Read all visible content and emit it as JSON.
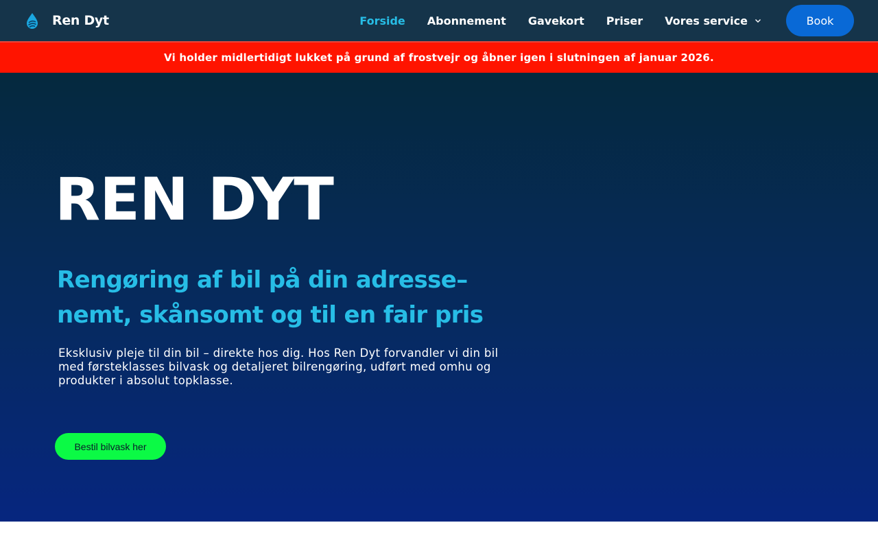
{
  "header": {
    "brand_name": "Ren Dyt",
    "logo_icon": "water-drop-icon",
    "nav": [
      {
        "label": "Forside",
        "active": true
      },
      {
        "label": "Abonnement"
      },
      {
        "label": "Gavekort"
      },
      {
        "label": "Priser"
      },
      {
        "label": "Vores service",
        "has_dropdown": true
      }
    ],
    "book_label": "Book"
  },
  "notice": {
    "text": "Vi holder midlertidigt lukket på grund af frostvejr og åbner igen i slutningen af januar 2026."
  },
  "hero": {
    "title": "REN DYT",
    "subtitle": "Rengøring af bil på din adresse– nemt, skånsomt og til en fair pris",
    "description": "Eksklusiv pleje til din bil – direkte hos dig. Hos Ren Dyt forvandler vi din bil med førsteklasses bilvask og detaljeret bilrengøring, udført med omhu og produkter i absolut topklasse.",
    "cta_label": "Bestil bilvask her"
  },
  "colors": {
    "nav_bg": "#15344a",
    "accent": "#27bde6",
    "book_button": "#0969d6",
    "notice_bg": "#ff1400",
    "cta_button": "#0bfa45"
  }
}
